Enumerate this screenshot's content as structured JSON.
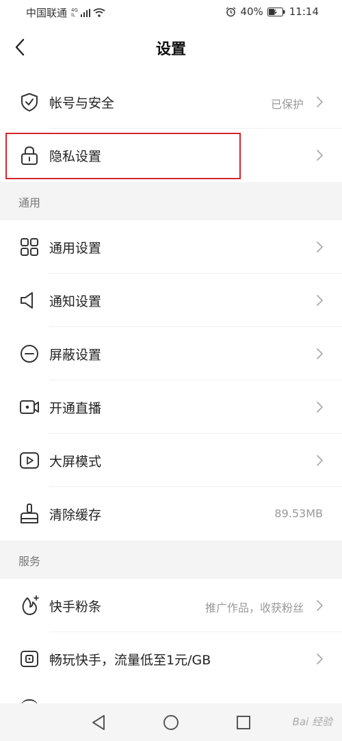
{
  "status": {
    "carrier": "中国联通",
    "network_top": "4G",
    "network_bottom": "lL",
    "battery": "40%",
    "time": "11:14"
  },
  "header": {
    "title": "设置"
  },
  "account": {
    "label": "帐号与安全",
    "value": "已保护"
  },
  "privacy": {
    "label": "隐私设置"
  },
  "sections": {
    "general": "通用",
    "services": "服务"
  },
  "general_items": [
    {
      "label": "通用设置"
    },
    {
      "label": "通知设置"
    },
    {
      "label": "屏蔽设置"
    },
    {
      "label": "开通直播"
    },
    {
      "label": "大屏模式"
    },
    {
      "label": "清除缓存",
      "value": "89.53MB"
    }
  ],
  "service_items": [
    {
      "label": "快手粉条",
      "value": "推广作品，收获粉丝"
    },
    {
      "label": "畅玩快手，流量低至1元/GB"
    }
  ],
  "watermark": "Bai 经验",
  "colors": {
    "highlight": "#d0262c",
    "section_bg": "#f4f4f4"
  }
}
